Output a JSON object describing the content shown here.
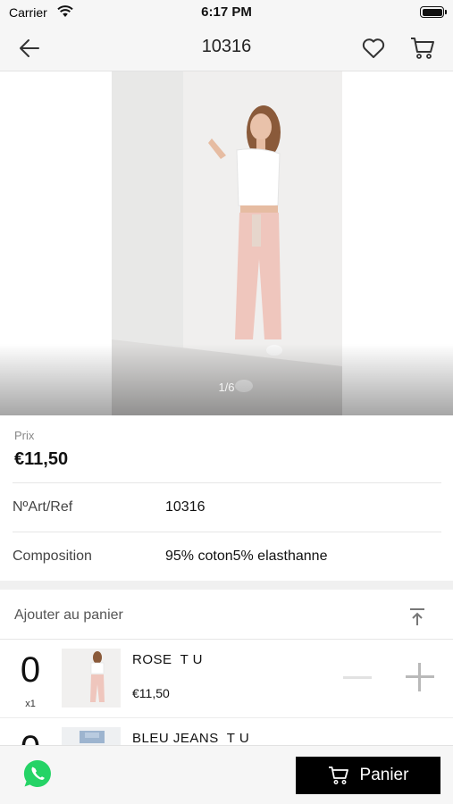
{
  "status_bar": {
    "carrier": "Carrier",
    "time": "6:17 PM"
  },
  "nav": {
    "title": "10316",
    "back_icon": "back-arrow-icon",
    "favorite_icon": "heart-icon",
    "cart_icon": "cart-icon"
  },
  "gallery": {
    "counter": "1/6"
  },
  "price": {
    "label": "Prix",
    "value": "€11,50"
  },
  "details": [
    {
      "label": "NºArt/Ref",
      "value": "10316"
    },
    {
      "label": "Composition",
      "value": "95% coton5% elasthanne"
    }
  ],
  "cart_section": {
    "header": "Ajouter au panier",
    "collapse_icon": "collapse-up-icon"
  },
  "variants": [
    {
      "name": "ROSE  T U",
      "price": "€11,50",
      "quantity": "0",
      "multiplier": "x1"
    },
    {
      "name": "BLEU JEANS  T U",
      "price": "",
      "quantity": "0",
      "multiplier": ""
    }
  ],
  "bottom_bar": {
    "panier_label": "Panier",
    "whatsapp_icon": "whatsapp-icon"
  },
  "colors": {
    "accent": "#000000",
    "whatsapp": "#25D366",
    "plus_icon": "#b9b9b9",
    "minus_icon": "#e2e2e2"
  }
}
